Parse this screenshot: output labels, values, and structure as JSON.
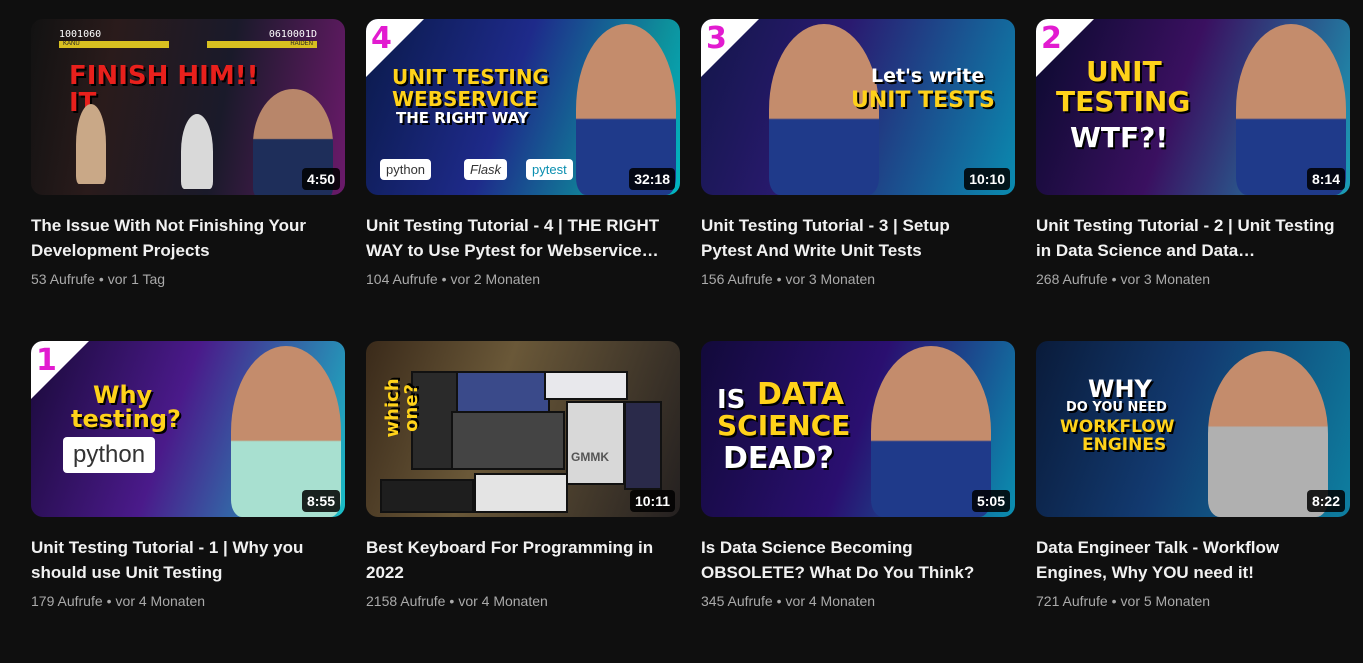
{
  "videos": [
    {
      "title": "The Issue With Not Finishing Your Development Projects",
      "views": "53 Aufrufe",
      "age": "vor 1 Tag",
      "duration": "4:50",
      "thumb_text": "FINISH HIM!! IT",
      "hud_left": "1001060",
      "hud_right": "0610001D",
      "hud_name_left": "KANU",
      "hud_name_right": "RAIDEN"
    },
    {
      "title": "Unit Testing Tutorial - 4 | THE RIGHT WAY to Use Pytest for Webservice…",
      "views": "104 Aufrufe",
      "age": "vor 2 Monaten",
      "duration": "32:18",
      "badge": "4",
      "thumb_line1": "UNIT TESTING",
      "thumb_line2": "WEBSERVICE",
      "thumb_line3": "THE RIGHT WAY",
      "logos": [
        "python",
        "Flask",
        "pytest"
      ]
    },
    {
      "title": "Unit Testing Tutorial - 3 | Setup Pytest And Write Unit Tests",
      "views": "156 Aufrufe",
      "age": "vor 3 Monaten",
      "duration": "10:10",
      "badge": "3",
      "thumb_line1": "Let's write",
      "thumb_line2": "UNIT TESTS"
    },
    {
      "title": "Unit Testing Tutorial - 2 | Unit Testing in Data Science and Data…",
      "views": "268 Aufrufe",
      "age": "vor 3 Monaten",
      "duration": "8:14",
      "badge": "2",
      "thumb_line1": "UNIT",
      "thumb_line2": "TESTING",
      "thumb_line3": "WTF?!"
    },
    {
      "title": "Unit Testing Tutorial - 1 | Why you should use Unit Testing",
      "views": "179 Aufrufe",
      "age": "vor 4 Monaten",
      "duration": "8:55",
      "badge": "1",
      "thumb_line1": "Why",
      "thumb_line2": "testing?",
      "logos": [
        "python"
      ]
    },
    {
      "title": "Best Keyboard For Programming in 2022",
      "views": "2158 Aufrufe",
      "age": "vor 4 Monaten",
      "duration": "10:11",
      "thumb_line1": "which one?",
      "thumb_line2": "GMMK"
    },
    {
      "title": "Is Data Science Becoming OBSOLETE? What Do You Think?",
      "views": "345 Aufrufe",
      "age": "vor 4 Monaten",
      "duration": "5:05",
      "thumb_line1": "IS",
      "thumb_line2": "DATA",
      "thumb_line3": "SCIENCE",
      "thumb_line4": "DEAD?"
    },
    {
      "title": "Data Engineer Talk - Workflow Engines, Why YOU need it!",
      "views": "721 Aufrufe",
      "age": "vor 5 Monaten",
      "duration": "8:22",
      "thumb_line1": "WHY",
      "thumb_line2": "DO YOU NEED",
      "thumb_line3": "WORKFLOW",
      "thumb_line4": "ENGINES"
    }
  ],
  "separator": "•"
}
